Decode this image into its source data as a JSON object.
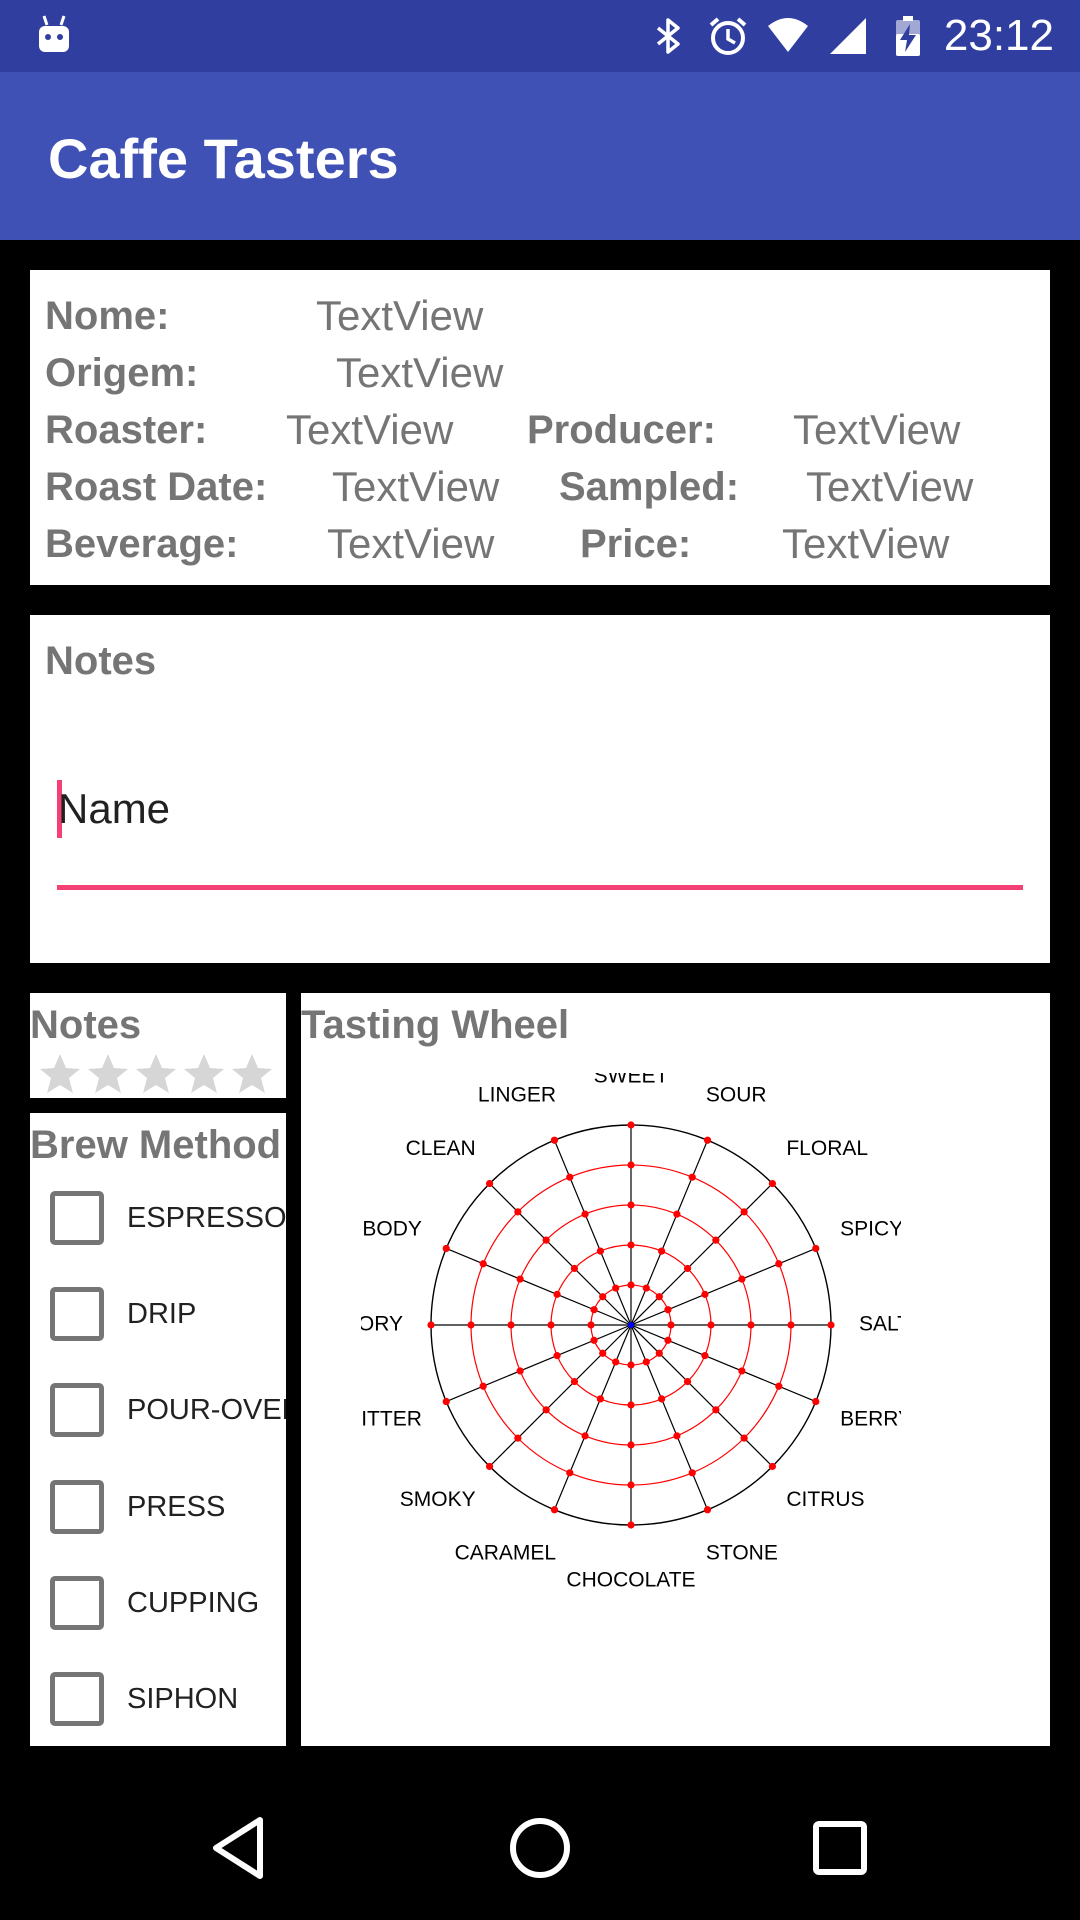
{
  "status_bar": {
    "time": "23:12",
    "icons": [
      "android-icon",
      "bluetooth-icon",
      "alarm-icon",
      "wifi-icon",
      "signal-icon",
      "battery-charging-icon"
    ]
  },
  "app_bar": {
    "title": "Caffe Tasters"
  },
  "info": {
    "nome_label": "Nome:",
    "nome_value": "TextView",
    "origem_label": "Origem:",
    "origem_value": "TextView",
    "roaster_label": "Roaster:",
    "roaster_value": "TextView",
    "producer_label": "Producer:",
    "producer_value": "TextView",
    "roast_date_label": "Roast Date:",
    "roast_date_value": "TextView",
    "sampled_label": "Sampled:",
    "sampled_value": "TextView",
    "beverage_label": "Beverage:",
    "beverage_value": "TextView",
    "price_label": "Price:",
    "price_value": "TextView"
  },
  "notes_card": {
    "title": "Notes",
    "input_value": "Name",
    "accent_color": "#F44074"
  },
  "rating": {
    "title": "Notes",
    "rating": 0,
    "max": 5
  },
  "brew_method": {
    "title": "Brew Method",
    "options": [
      {
        "label": "ESPRESSO",
        "checked": false
      },
      {
        "label": "DRIP",
        "checked": false
      },
      {
        "label": "POUR-OVER",
        "checked": false
      },
      {
        "label": "PRESS",
        "checked": false
      },
      {
        "label": "CUPPING",
        "checked": false
      },
      {
        "label": "SIPHON",
        "checked": false
      }
    ]
  },
  "tasting_wheel": {
    "title": "Tasting Wheel",
    "attributes": [
      "SWEET",
      "SOUR",
      "FLORAL",
      "SPICY",
      "SALTY",
      "BERRY",
      "CITRUS",
      "STONE",
      "CHOCOLATE",
      "CARAMEL",
      "SMOKY",
      "BITTER",
      "SAVORY",
      "BODY",
      "CLEAN",
      "LINGER"
    ],
    "ring_count": 5,
    "colors": {
      "rings": "#FF0000",
      "outer_ring": "#000000",
      "spokes": "#000000",
      "points": "#FF0000",
      "center": "#0000FF"
    }
  },
  "nav_bar": {
    "buttons": [
      "back-icon",
      "home-icon",
      "recents-icon"
    ]
  },
  "theme": {
    "primary": "#3F51B5",
    "primary_dark": "#303F9F",
    "accent": "#F44074",
    "label_gray": "#757575"
  }
}
